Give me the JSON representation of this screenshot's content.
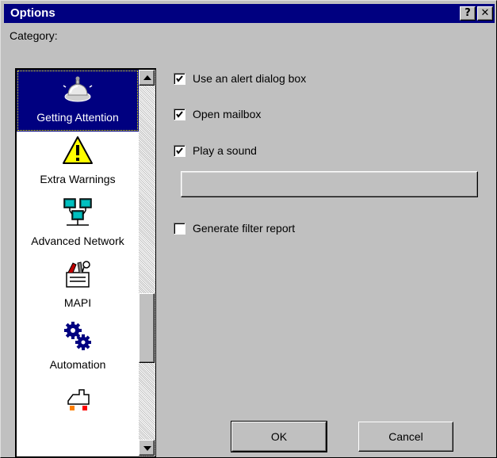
{
  "window": {
    "title": "Options"
  },
  "titlebar": {
    "help_label": "?",
    "close_label": "✕"
  },
  "category": {
    "label": "Category:",
    "items": [
      {
        "label": "Getting Attention",
        "icon": "bell-icon",
        "selected": true
      },
      {
        "label": "Extra Warnings",
        "icon": "warning-icon",
        "selected": false
      },
      {
        "label": "Advanced Network",
        "icon": "network-icon",
        "selected": false
      },
      {
        "label": "MAPI",
        "icon": "mapi-icon",
        "selected": false
      },
      {
        "label": "Automation",
        "icon": "gears-icon",
        "selected": false
      },
      {
        "label": "",
        "icon": "plugin-icon",
        "selected": false
      }
    ]
  },
  "options": {
    "alert_dialog": {
      "label": "Use an alert dialog box",
      "checked": true
    },
    "open_mailbox": {
      "label": "Open mailbox",
      "checked": true
    },
    "play_sound": {
      "label": "Play a sound",
      "checked": true
    },
    "sound_file": {
      "value": ""
    },
    "filter_report": {
      "label": "Generate filter report",
      "checked": false
    }
  },
  "buttons": {
    "ok": "OK",
    "cancel": "Cancel"
  },
  "colors": {
    "titlebar": "#000080",
    "face": "#c0c0c0",
    "selection": "#000080"
  }
}
